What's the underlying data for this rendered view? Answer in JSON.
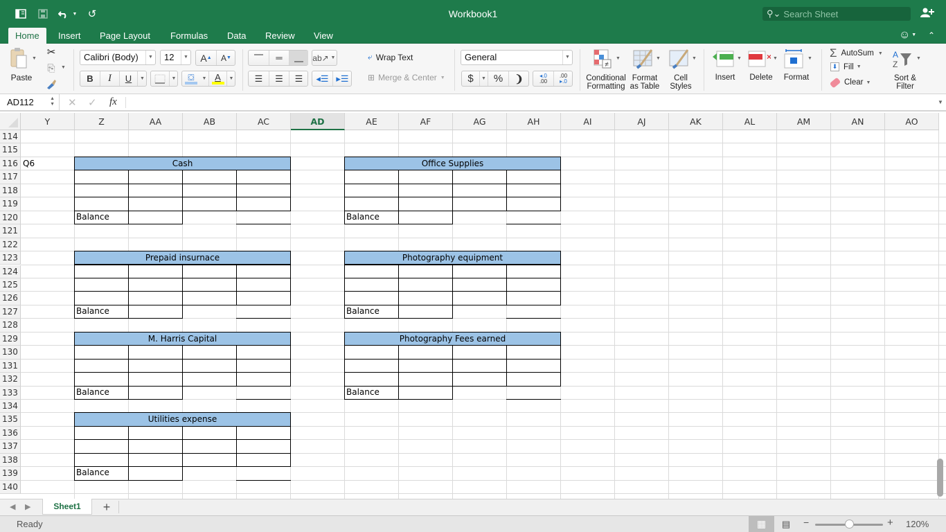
{
  "window": {
    "title": "Workbook1",
    "search_placeholder": "Search Sheet"
  },
  "quick_access": {
    "sidebar_icon": "sidebar-toggle-icon",
    "save_icon": "save-icon",
    "undo_icon": "undo-icon",
    "redo_icon": "redo-icon"
  },
  "tabs": [
    {
      "label": "Home",
      "active": true
    },
    {
      "label": "Insert"
    },
    {
      "label": "Page Layout"
    },
    {
      "label": "Formulas"
    },
    {
      "label": "Data"
    },
    {
      "label": "Review"
    },
    {
      "label": "View"
    }
  ],
  "ribbon": {
    "paste_label": "Paste",
    "font_name": "Calibri (Body)",
    "font_size": "12",
    "bold": "B",
    "italic": "I",
    "underline": "U",
    "wrap_text": "Wrap Text",
    "merge_center": "Merge & Center",
    "number_format": "General",
    "currency": "$",
    "percent": "%",
    "comma": "’",
    "conditional_formatting": [
      "Conditional",
      "Formatting"
    ],
    "format_as_table": [
      "Format",
      "as Table"
    ],
    "cell_styles": [
      "Cell",
      "Styles"
    ],
    "insert": "Insert",
    "delete": "Delete",
    "format": "Format",
    "autosum": "AutoSum",
    "fill": "Fill",
    "clear": "Clear",
    "sort_filter": [
      "Sort &",
      "Filter"
    ],
    "colors": {
      "fill_color": "#a4c8f0",
      "font_color": "#ffff00"
    }
  },
  "formula_bar": {
    "name_box": "AD112",
    "cancel": "✕",
    "enter": "✓",
    "fx": "fx",
    "formula": ""
  },
  "grid": {
    "columns": [
      "Y",
      "Z",
      "AA",
      "AB",
      "AC",
      "AD",
      "AE",
      "AF",
      "AG",
      "AH",
      "AI",
      "AJ",
      "AK",
      "AL",
      "AM",
      "AN",
      "AO"
    ],
    "selected_column": "AD",
    "rows": [
      "114",
      "115",
      "116",
      "117",
      "118",
      "119",
      "120",
      "121",
      "122",
      "123",
      "124",
      "125",
      "126",
      "127",
      "128",
      "129",
      "130",
      "131",
      "132",
      "133",
      "134",
      "135",
      "136",
      "137",
      "138",
      "139",
      "140"
    ],
    "cells": {
      "Y116": "Q6"
    },
    "t_accounts": [
      {
        "title": "Cash",
        "header_row": "116",
        "col": "Z",
        "balance_label": "Balance"
      },
      {
        "title": "Office Supplies",
        "header_row": "116",
        "col": "AE",
        "balance_label": "Balance"
      },
      {
        "title": "Prepaid insurnace",
        "header_row": "123",
        "col": "Z",
        "balance_label": "Balance"
      },
      {
        "title": "Photography equipment",
        "header_row": "123",
        "col": "AE",
        "balance_label": "Balance"
      },
      {
        "title": "M. Harris Capital",
        "header_row": "129",
        "col": "Z",
        "balance_label": "Balance"
      },
      {
        "title": "Photography Fees earned",
        "header_row": "129",
        "col": "AE",
        "balance_label": "Balance"
      },
      {
        "title": "Utilities expense",
        "header_row": "135",
        "col": "Z",
        "balance_label": "Balance"
      }
    ],
    "header_fill": "#9cc3e6"
  },
  "sheets": [
    {
      "label": "Sheet1",
      "active": true
    }
  ],
  "add_sheet": "+",
  "status": {
    "text": "Ready",
    "zoom": "120%",
    "zoom_fraction": 0.5
  }
}
